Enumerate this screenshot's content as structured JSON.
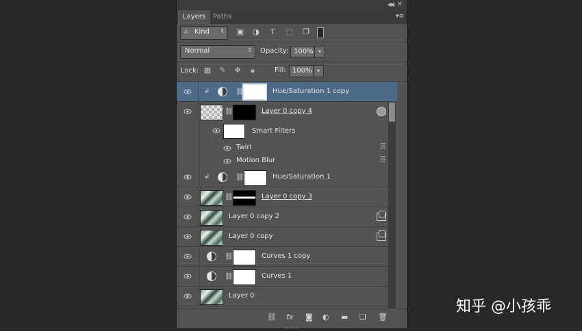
{
  "panel": {
    "tabs": [
      {
        "label": "Layers",
        "active": true
      },
      {
        "label": "Paths",
        "active": false
      }
    ],
    "filter": {
      "kind_label": "Kind",
      "icons": [
        "image-filter-icon",
        "adjustment-filter-icon",
        "type-filter-icon",
        "shape-filter-icon",
        "smart-object-filter-icon",
        "filter-toggle-icon"
      ]
    },
    "blend_mode": "Normal",
    "opacity_label": "Opacity:",
    "opacity_value": "100%",
    "lock_label": "Lock:",
    "fill_label": "Fill:",
    "fill_value": "100%",
    "lock_icons": [
      "lock-transparent-icon",
      "lock-image-icon",
      "lock-position-icon",
      "lock-all-icon"
    ]
  },
  "layers": [
    {
      "name": "Hue/Saturation 1 copy",
      "type": "adjustment",
      "selected": true,
      "clipped": true
    },
    {
      "name": "Layer 0 copy 4",
      "type": "smart",
      "selected": false,
      "underline": true,
      "smart_filters_label": "Smart Filters",
      "filters": [
        {
          "name": "Twirl"
        },
        {
          "name": "Motion Blur"
        }
      ]
    },
    {
      "name": "Hue/Saturation 1",
      "type": "adjustment",
      "selected": false,
      "clipped": true
    },
    {
      "name": "Layer 0 copy 3",
      "type": "masked",
      "selected": false,
      "underline": true
    },
    {
      "name": "Layer 0 copy 2",
      "type": "smartobj",
      "selected": false
    },
    {
      "name": "Layer 0 copy",
      "type": "smartobj",
      "selected": false
    },
    {
      "name": "Curves 1 copy",
      "type": "curves",
      "selected": false
    },
    {
      "name": "Curves 1",
      "type": "curves",
      "selected": false
    },
    {
      "name": "Layer 0",
      "type": "image",
      "selected": false
    }
  ],
  "bottom_icons": [
    "link-layers-icon",
    "fx-icon",
    "add-mask-icon",
    "new-adjustment-icon",
    "new-group-icon",
    "new-layer-icon",
    "delete-layer-icon"
  ],
  "bottom_fx_label": "fx",
  "watermark": "知乎 @小孩乖",
  "colors": {
    "panel_bg": "#535353",
    "selected_row": "#4e6a89",
    "window_bg": "#282828"
  }
}
